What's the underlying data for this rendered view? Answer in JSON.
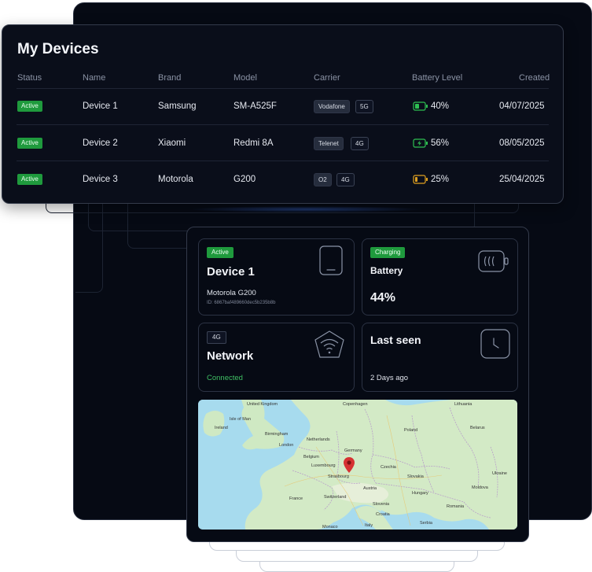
{
  "devices_table": {
    "title": "My Devices",
    "columns": [
      "Status",
      "Name",
      "Brand",
      "Model",
      "Carrier",
      "Battery Level",
      "Created"
    ],
    "rows": [
      {
        "status": "Active",
        "name": "Device 1",
        "brand": "Samsung",
        "model": "SM-A525F",
        "carrier": "Vodafone",
        "network": "5G",
        "battery": "40%",
        "battery_state": "normal",
        "created": "04/07/2025"
      },
      {
        "status": "Active",
        "name": "Device 2",
        "brand": "Xiaomi",
        "model": "Redmi 8A",
        "carrier": "Telenet",
        "network": "4G",
        "battery": "56%",
        "battery_state": "charging",
        "created": "08/05/2025"
      },
      {
        "status": "Active",
        "name": "Device 3",
        "brand": "Motorola",
        "model": "G200",
        "carrier": "O2",
        "network": "4G",
        "battery": "25%",
        "battery_state": "low",
        "created": "25/04/2025"
      }
    ]
  },
  "device_detail": {
    "device": {
      "status": "Active",
      "name": "Device 1",
      "model": "Motorola G200",
      "id_text": "ID: 6867baf489660dec5b235b8b",
      "icon": "smartphone-icon"
    },
    "battery": {
      "badge": "Charging",
      "label": "Battery",
      "value": "44%",
      "icon": "battery-charging-icon"
    },
    "network": {
      "badge": "4G",
      "label": "Network",
      "status": "Connected",
      "icon": "wifi-icon"
    },
    "last_seen": {
      "label": "Last seen",
      "value": "2 Days ago",
      "icon": "clock-icon"
    },
    "map": {
      "labels": [
        "United Kingdom",
        "Isle of Man",
        "Ireland",
        "Birmingham",
        "London",
        "Netherlands",
        "Belgium",
        "Luxembourg",
        "Strasbourg",
        "France",
        "Switzerland",
        "Germany",
        "Czechia",
        "Poland",
        "Lithuania",
        "Belarus",
        "Slovakia",
        "Ukraine",
        "Austria",
        "Hungary",
        "Moldova",
        "Romania",
        "Slovenia",
        "Croatia",
        "Serbia",
        "Italy",
        "Monaco",
        "Copenhagen"
      ],
      "pin_icon": "map-pin-icon"
    }
  },
  "colors": {
    "active_green": "#1f9a3d",
    "connected_green": "#3fbf63",
    "battery_green": "#2ec052",
    "battery_amber": "#e0a020",
    "pin_red": "#d63232"
  }
}
